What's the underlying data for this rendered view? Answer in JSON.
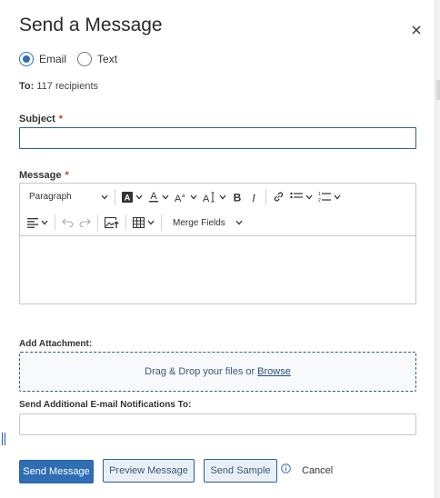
{
  "dialog": {
    "title": "Send a Message"
  },
  "message_type": {
    "options": [
      {
        "label": "Email",
        "selected": true
      },
      {
        "label": "Text",
        "selected": false
      }
    ]
  },
  "recipients": {
    "prefix": "To:",
    "text": "117 recipients"
  },
  "subject": {
    "label": "Subject",
    "required_mark": "*",
    "value": ""
  },
  "message": {
    "label": "Message",
    "required_mark": "*",
    "toolbar": {
      "paragraph_label": "Paragraph",
      "merge_fields_label": "Merge Fields"
    },
    "body": ""
  },
  "attachment": {
    "label": "Add Attachment:",
    "drop_text": "Drag & Drop your files or",
    "browse_label": "Browse"
  },
  "notifications": {
    "label": "Send Additional E-mail Notifications To:",
    "value": ""
  },
  "footer": {
    "send_label": "Send Message",
    "preview_label": "Preview Message",
    "sample_label": "Send Sample",
    "cancel_label": "Cancel"
  },
  "colors": {
    "primary": "#2f6eb5",
    "required": "#c0392b"
  }
}
